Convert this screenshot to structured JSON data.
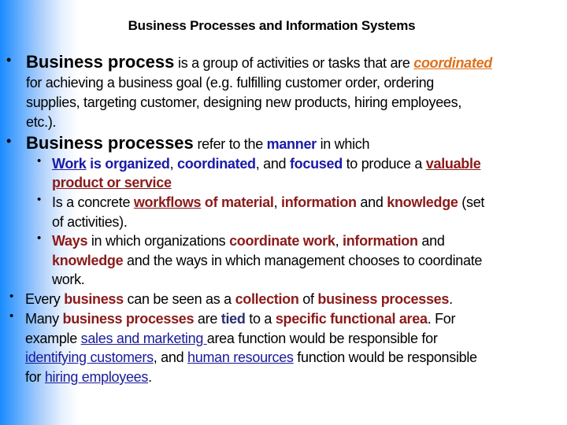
{
  "slide": {
    "title": "Business Processes and Information Systems",
    "colors": {
      "gradient_left": "#1a8cff",
      "emphasis_blue": "#1a1aa6",
      "emphasis_red": "#8b1a1a",
      "emphasis_navy": "#2a2e6e",
      "emphasis_orange": "#e0701a",
      "link": "#1a1a9a"
    },
    "bullet_glyph": "•",
    "b1": {
      "term": "Business process",
      "t1": " is a group of activities or tasks that are ",
      "coordinated": "coordinated",
      "line2": "for achieving a business goal (e.g. fulfilling customer order, ordering",
      "line3": "supplies, targeting customer, designing new products, hiring employees,",
      "line4": "etc.)."
    },
    "b2": {
      "term": "Business processes",
      "t1": " refer to the ",
      "manner": "manner",
      "t2": " in which"
    },
    "sub1": {
      "work": "Work",
      "is_organized": " is organized",
      "c1": ", ",
      "coordinated": "coordinated",
      "c2": ", and ",
      "focused": "focused",
      "t1": " to produce a ",
      "valuable": "valuable",
      "product": "product or service"
    },
    "sub2": {
      "t1": "Is a concrete ",
      "workflows": "workflows",
      "of_material": " of material",
      "c1": ", ",
      "information": "information",
      "t2": " and ",
      "knowledge": "knowledge",
      "t3": " (set",
      "line2": "of activities)."
    },
    "sub3": {
      "ways": "Ways",
      "t1": " in which organizations ",
      "coordinate_work": "coordinate work",
      "c1": ", ",
      "information": "information",
      "t2": " and",
      "knowledge": "knowledge",
      "t3": " and the ways in which management chooses to coordinate",
      "line3": "work."
    },
    "b3": {
      "t1": "Every ",
      "business": "business",
      "t2": " can be seen as a ",
      "collection": "collection",
      "t3": " of ",
      "business_processes": "business processes",
      "t4": "."
    },
    "b4": {
      "t1": "Many ",
      "business_processes": "business processes",
      "t2": " are ",
      "tied": "tied",
      "t3": " to a ",
      "specific_area": "specific functional area",
      "t4": ". For",
      "t5": "example ",
      "sales_marketing": "sales and marketing ",
      "t6": "area function would be responsible for",
      "identifying_customers": "identifying customers",
      "t7": ", and ",
      "human_resources": "human resources",
      "t8": " function would be responsible",
      "t9": "for ",
      "hiring_employees": "hiring employees",
      "t10": "."
    }
  }
}
